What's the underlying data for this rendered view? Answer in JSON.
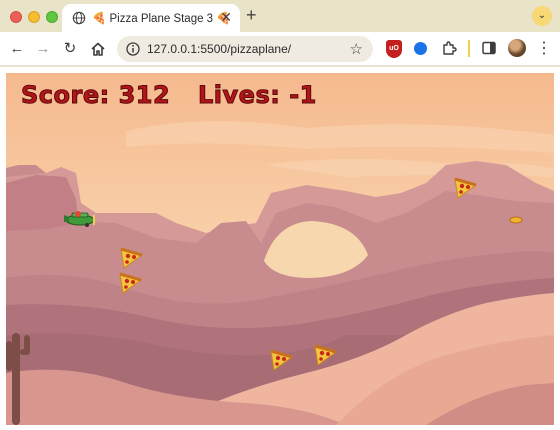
{
  "browser": {
    "tab_title": "🍕 Pizza Plane Stage 3 🍕",
    "url": "127.0.0.1:5500/pizzaplane/"
  },
  "game": {
    "score_label": "Score:",
    "score": "312",
    "lives_label": "Lives:",
    "lives": "-1",
    "colors": {
      "hud_text": "#b3141a",
      "sky": "#f7c9a0",
      "mesa": "#c98c8e",
      "dune": "#f2b7a0"
    }
  }
}
